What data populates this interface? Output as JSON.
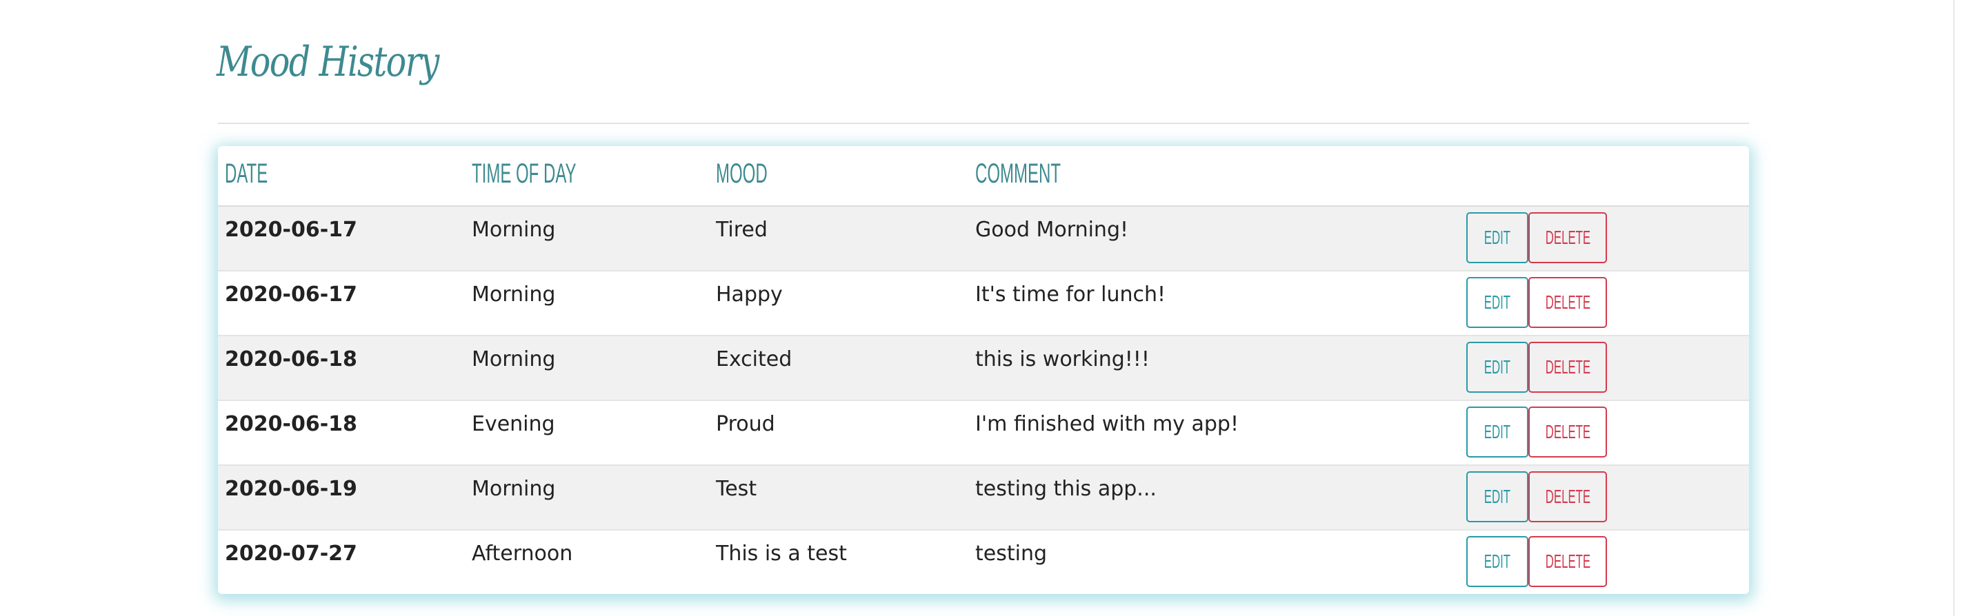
{
  "page": {
    "title": "Mood History"
  },
  "table": {
    "headers": {
      "date": "Date",
      "time_of_day": "Time of Day",
      "mood": "Mood",
      "comment": "Comment"
    },
    "rows": [
      {
        "date": "2020-06-17",
        "time_of_day": "Morning",
        "mood": "Tired",
        "comment": "Good Morning!",
        "edit_label": "Edit",
        "delete_label": "Delete"
      },
      {
        "date": "2020-06-17",
        "time_of_day": "Morning",
        "mood": "Happy",
        "comment": "It's time for lunch!",
        "edit_label": "Edit",
        "delete_label": "Delete"
      },
      {
        "date": "2020-06-18",
        "time_of_day": "Morning",
        "mood": "Excited",
        "comment": "this is working!!!",
        "edit_label": "Edit",
        "delete_label": "Delete"
      },
      {
        "date": "2020-06-18",
        "time_of_day": "Evening",
        "mood": "Proud",
        "comment": "I'm finished with my app!",
        "edit_label": "Edit",
        "delete_label": "Delete"
      },
      {
        "date": "2020-06-19",
        "time_of_day": "Morning",
        "mood": "Test",
        "comment": "testing this app...",
        "edit_label": "Edit",
        "delete_label": "Delete"
      },
      {
        "date": "2020-07-27",
        "time_of_day": "Afternoon",
        "mood": "This is a test",
        "comment": "testing",
        "edit_label": "Edit",
        "delete_label": "Delete"
      }
    ]
  },
  "colors": {
    "accent": "#3d8a90",
    "edit": "#2a9aa6",
    "delete": "#d43a4e",
    "shadow": "#78cdd7",
    "stripe": "#f1f1f1"
  }
}
